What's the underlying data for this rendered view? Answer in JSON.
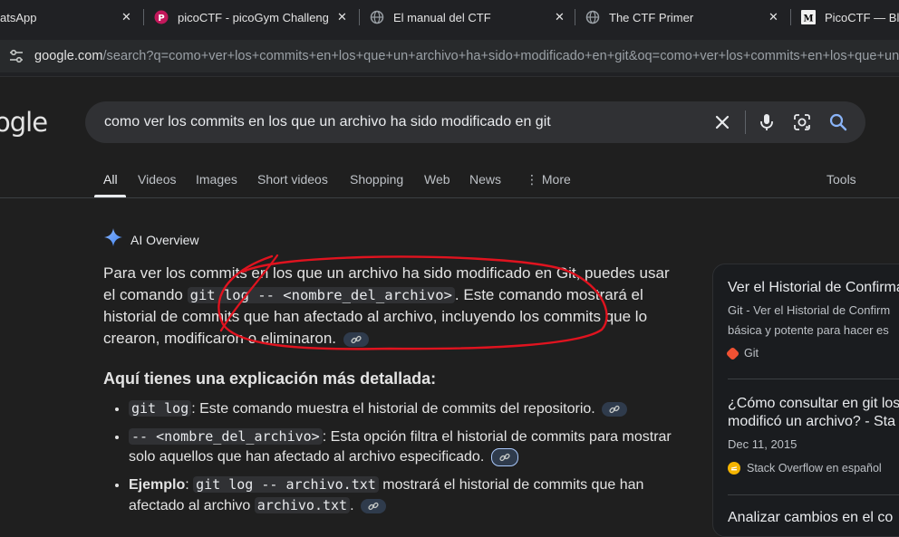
{
  "browser": {
    "tabs": [
      {
        "title": "atsApp"
      },
      {
        "title": "picoCTF - picoGym Challeng"
      },
      {
        "title": "El manual del CTF"
      },
      {
        "title": "The CTF Primer"
      },
      {
        "title": "PicoCTF — Bla"
      }
    ],
    "close_glyph": "✕",
    "url_host": "google.com",
    "url_rest": "/search?q=como+ver+los+commits+en+los+que+un+archivo+ha+sido+modificado+en+git&oq=como+ver+los+commits+en+los+que+un+archivo+ha+sido"
  },
  "google": {
    "logo_text": "ogle",
    "query": "como ver los commits en los que un archivo ha sido modificado en git",
    "tabs": [
      "All",
      "Videos",
      "Images",
      "Short videos",
      "Shopping",
      "Web",
      "News"
    ],
    "more": "More",
    "tools": "Tools"
  },
  "ai_overview": {
    "label": "AI Overview",
    "p1": "Para ver los commits en los que un archivo ha sido modificado en Git, puedes usar el comando ",
    "p1_code": "git log -- <nombre_del_archivo>",
    "p1_rest": ". Este comando mostrará el historial de commits que han afectado al archivo, incluyendo los commits que lo crearon, modificaron o eliminaron.",
    "subheading": "Aquí tienes una explicación más detallada:",
    "b1_code": "git log",
    "b1_text": ": Este comando muestra el historial de commits del repositorio.",
    "b2_code": "-- <nombre_del_archivo>",
    "b2_text": ": Esta opción filtra el historial de commits para mostrar solo aquellos que han afectado al archivo especificado.",
    "b3_bold": "Ejemplo",
    "b3_sep": ": ",
    "b3_code": "git log -- archivo.txt",
    "b3_text": " mostrará el historial de commits que han afectado al archivo ",
    "b3_code2": "archivo.txt",
    "b3_end": "."
  },
  "sources": [
    {
      "title": "Ver el Historial de Confirma",
      "snippet1": "Git - Ver el Historial de Confirm",
      "snippet2": "básica y potente para hacer es",
      "site": "Git"
    },
    {
      "title1": "¿Cómo consultar en git los",
      "title2": "modificó un archivo? - Sta",
      "date": "Dec 11, 2015",
      "site": "Stack Overflow en español"
    },
    {
      "title": "Analizar cambios en el co"
    }
  ],
  "colors": {
    "accent": "#a8c7fa",
    "annotation": "#e0131f",
    "page_bg": "#1f1f1f"
  }
}
